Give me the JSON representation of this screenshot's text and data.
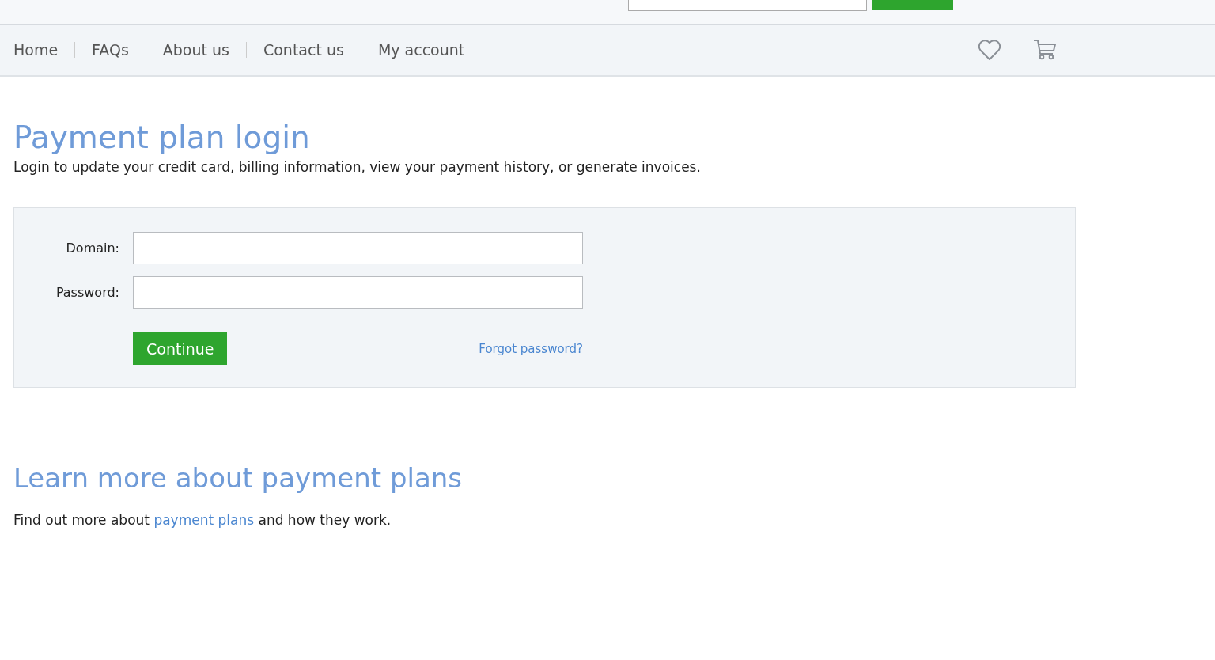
{
  "nav": {
    "items": [
      {
        "label": "Home"
      },
      {
        "label": "FAQs"
      },
      {
        "label": "About us"
      },
      {
        "label": "Contact us"
      },
      {
        "label": "My account"
      }
    ]
  },
  "login": {
    "title": "Payment plan login",
    "intro": "Login to update your credit card, billing information, view your payment history, or generate invoices.",
    "fields": [
      {
        "label": "Domain:"
      },
      {
        "label": "Password:"
      }
    ],
    "submit": "Continue",
    "forgot": "Forgot password?"
  },
  "learn": {
    "title": "Learn more about payment plans",
    "before": "Find out more about ",
    "link": "payment plans",
    "after": " and how they work."
  }
}
